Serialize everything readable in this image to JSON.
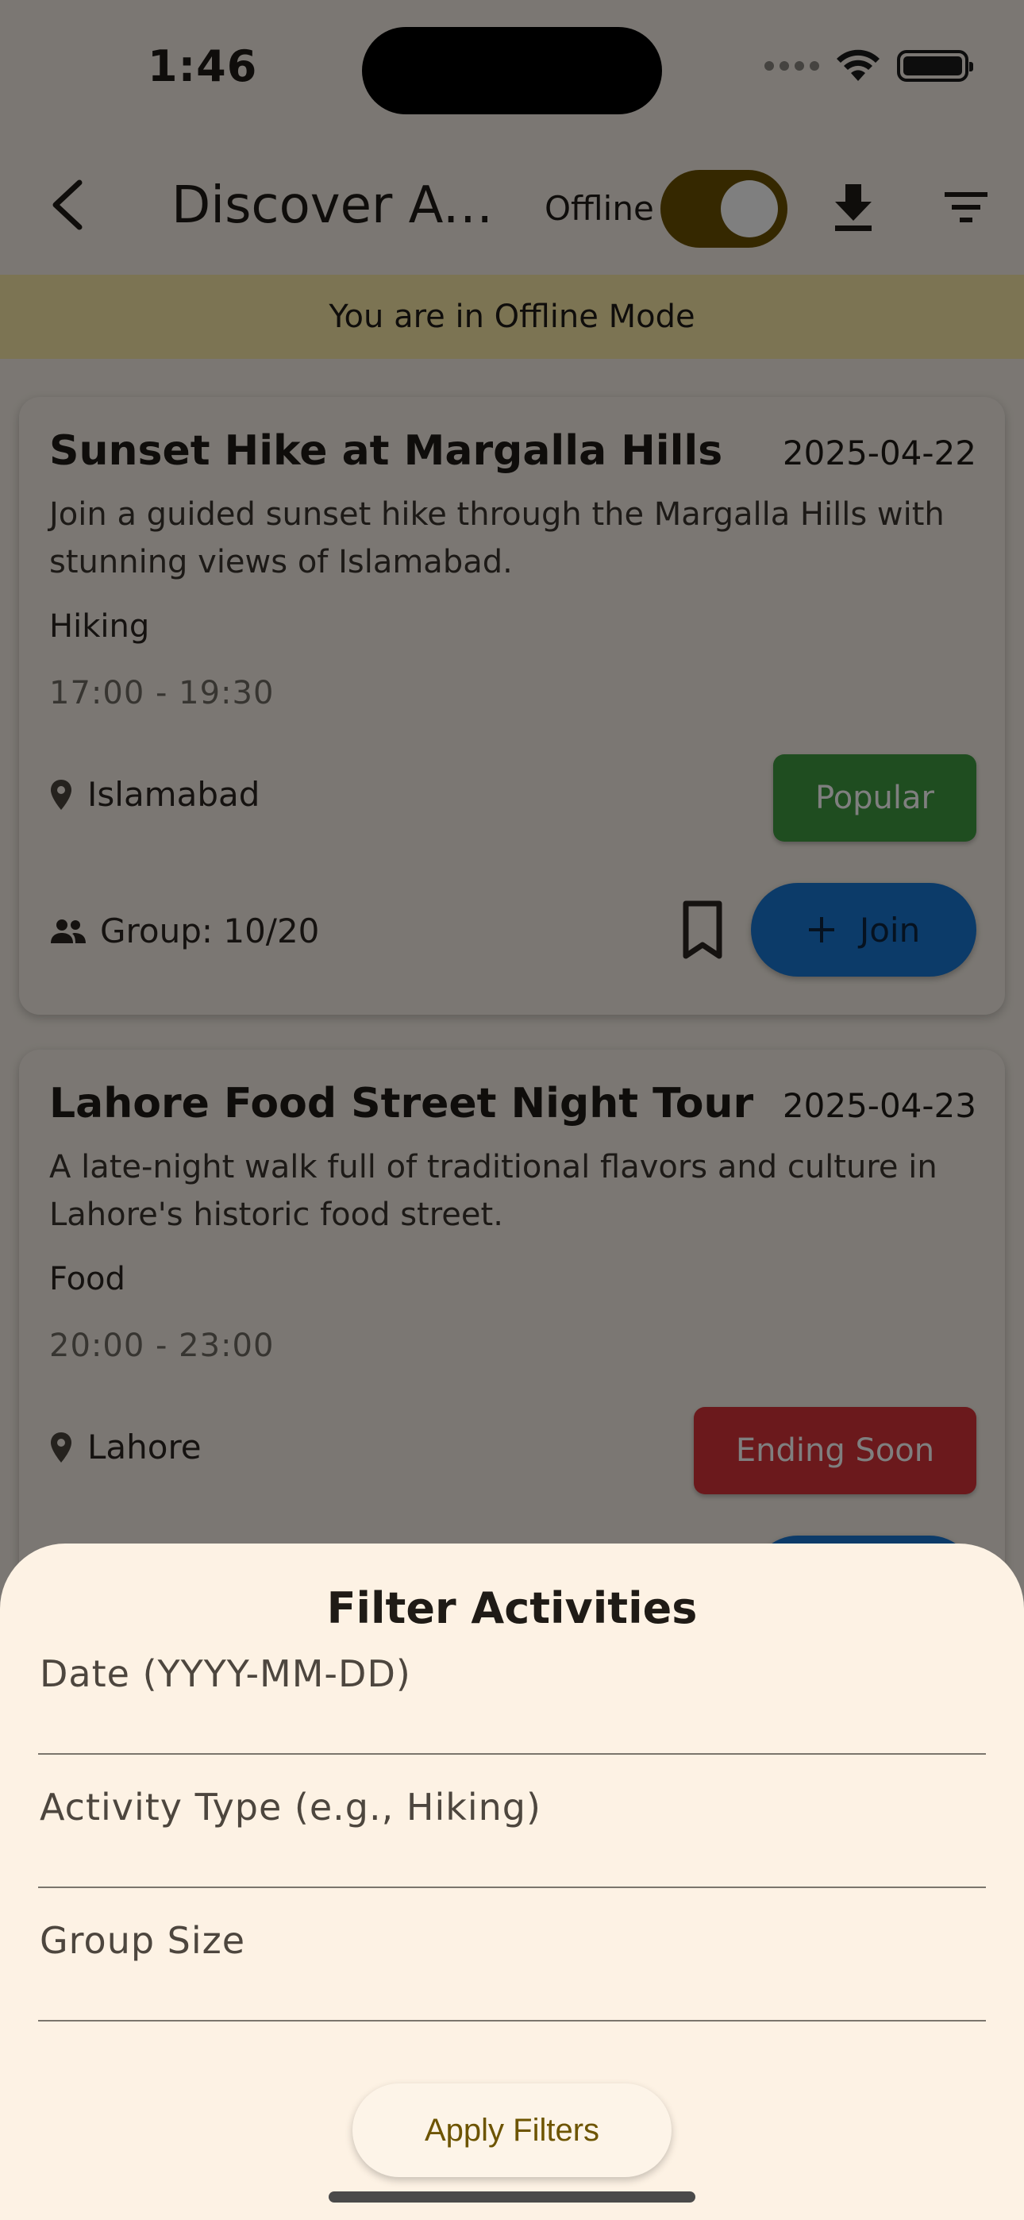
{
  "status_bar": {
    "time": "1:46"
  },
  "app_bar": {
    "title": "Discover Acti...",
    "offline_label": "Offline",
    "offline_toggle_on": true,
    "accent_color": "#6a5000"
  },
  "offline_banner": {
    "text": "You are in Offline Mode",
    "color": "#f9e9a6"
  },
  "activities": [
    {
      "title": "Sunset Hike at Margalla Hills",
      "date": "2025-04-22",
      "description": "Join a guided sunset hike through the Margalla Hills with stunning views of Islamabad.",
      "type": "Hiking",
      "time": "17:00 - 19:30",
      "location": "Islamabad",
      "badge": "Popular",
      "badge_color": "#3f9a40",
      "group": "Group: 10/20",
      "join_label": "Join"
    },
    {
      "title": "Lahore Food Street Night Tour",
      "date": "2025-04-23",
      "description": "A late-night walk full of traditional flavors and culture in Lahore's historic food street.",
      "type": "Food",
      "time": "20:00 - 23:00",
      "location": "Lahore",
      "badge": "Ending Soon",
      "badge_color": "#d63238"
    }
  ],
  "filter_sheet": {
    "title": "Filter Activities",
    "fields": [
      {
        "placeholder": "Date (YYYY-MM-DD)",
        "value": ""
      },
      {
        "placeholder": "Activity Type (e.g., Hiking)",
        "value": ""
      },
      {
        "placeholder": "Group Size",
        "value": ""
      }
    ],
    "apply_label": "Apply Filters"
  }
}
